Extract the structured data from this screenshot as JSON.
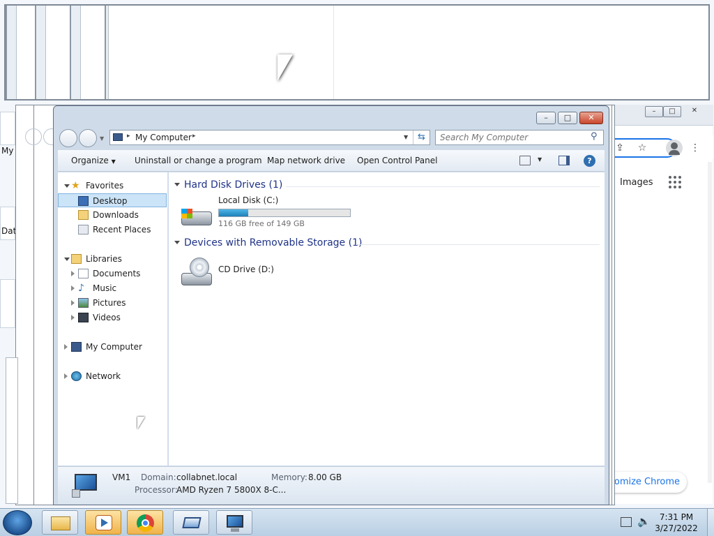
{
  "desktop": {
    "icons": [
      {
        "label": "My"
      },
      {
        "label": "Dat"
      }
    ]
  },
  "chrome": {
    "images_link": "Images",
    "customize_label": "Customize Chrome",
    "customize_visible": "stomize Chrome"
  },
  "explorer": {
    "address": {
      "crumb": "My Computer"
    },
    "search": {
      "placeholder": "Search My Computer"
    },
    "toolbar": {
      "organize": "Organize",
      "uninstall": "Uninstall or change a program",
      "map_drive": "Map network drive",
      "control_panel": "Open Control Panel"
    },
    "nav": {
      "favorites": "Favorites",
      "desktop": "Desktop",
      "downloads": "Downloads",
      "recent_places": "Recent Places",
      "libraries": "Libraries",
      "documents": "Documents",
      "music": "Music",
      "pictures": "Pictures",
      "videos": "Videos",
      "my_computer": "My Computer",
      "network": "Network"
    },
    "content": {
      "hdd_group": "Hard Disk Drives (1)",
      "local_disk_name": "Local Disk (C:)",
      "local_disk_free": "116 GB free of 149 GB",
      "local_disk_used_fraction": 0.221,
      "removable_group": "Devices with Removable Storage (1)",
      "cd_drive_name": "CD Drive (D:)"
    },
    "details": {
      "computer_name": "VM1",
      "domain_label": "Domain:",
      "domain_value": "collabnet.local",
      "memory_label": "Memory:",
      "memory_value": "8.00 GB",
      "processor_label": "Processor:",
      "processor_value": "AMD Ryzen 7 5800X 8-C..."
    }
  },
  "taskbar": {
    "time": "7:31 PM",
    "date": "3/27/2022"
  },
  "colors": {
    "accent": "#1a73e8",
    "disk_fill": "#2a94cf",
    "group_title": "#1e3287",
    "close_button": "#c9462c"
  }
}
